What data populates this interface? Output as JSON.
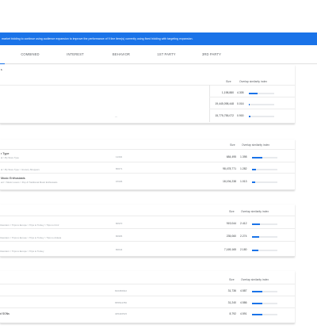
{
  "banner": {
    "text": "market bidding to continue using audience expansion to improve the performance of 9 line item(s) currently using fixed bidding with targeting expansion."
  },
  "tabs": [
    "COMBINED",
    "INTEREST",
    "BEHAVIOR",
    "1ST PARTY",
    "3RD PARTY"
  ],
  "cards": [
    {
      "headers": {
        "size": "Size",
        "overlap": "Overlap similarity index"
      },
      "title_fragment": "s",
      "rows": [
        {
          "title": "",
          "sub": "",
          "code": "",
          "size": "1,198,880",
          "index": "4.305",
          "fill": 0.35
        },
        {
          "title": "",
          "sub": "",
          "code": "",
          "size": "19,445,098,448",
          "index": "0.016",
          "fill": 0.02
        },
        {
          "title": "",
          "sub": "",
          "code": "",
          "size": "15,775,755,072",
          "index": "0.900",
          "fill": 0.05
        }
      ]
    },
    {
      "headers": {
        "size": "Size",
        "overlap": "Overlap similarity index"
      },
      "rows": [
        {
          "title": "r Type",
          "sub": "al > By Store Type",
          "code": "11302",
          "size": "684,495",
          "index": "1.398",
          "fill": 0.4
        },
        {
          "title": "",
          "sub": "al > By Store Type > Grocery Shoppers",
          "code": "80071",
          "size": "98,478,771",
          "index": "1.282",
          "fill": 0.15
        },
        {
          "title": "Music Enthusiasts",
          "sub": "ent > Music Lovers > Pop & Traditional Music Enthusiasts",
          "code": "97005",
          "size": "18,194,238",
          "index": "1.013",
          "fill": 0.12
        }
      ]
    },
    {
      "headers": {
        "size": "Size",
        "overlap": "Overlap similarity index"
      },
      "rows": [
        {
          "title": "",
          "sub": "Intenders > Trips to Europe > Trips to Turkey > Trips to Izmir",
          "code": "80970",
          "size": "919,044",
          "index": "2.412",
          "fill": 0.3
        },
        {
          "title": "",
          "sub": "Intenders > Trips to Europe > Trips to Turkey > Trips to Ankara",
          "code": "80965",
          "size": "235,060",
          "index": "2.274",
          "fill": 0.28
        },
        {
          "title": "",
          "sub": "Intenders > Trips to Europe > Trips to Turkey",
          "code": "80644",
          "size": "7,169,165",
          "index": "2.180",
          "fill": 0.25
        }
      ]
    },
    {
      "headers": {
        "size": "Size",
        "overlap": "Overlap similarity index"
      },
      "rows": [
        {
          "title": "",
          "sub": "",
          "code": "816456642",
          "size": "31,736",
          "index": "4.587",
          "fill": 0.4
        },
        {
          "title": "",
          "sub": "",
          "code": "655544780",
          "size": "31,240",
          "index": "4.586",
          "fill": 0.4
        },
        {
          "title": "d SGNs",
          "sub": "",
          "code": "405446515",
          "size": "8,792",
          "index": "4.591",
          "fill": 0.4
        }
      ]
    }
  ]
}
